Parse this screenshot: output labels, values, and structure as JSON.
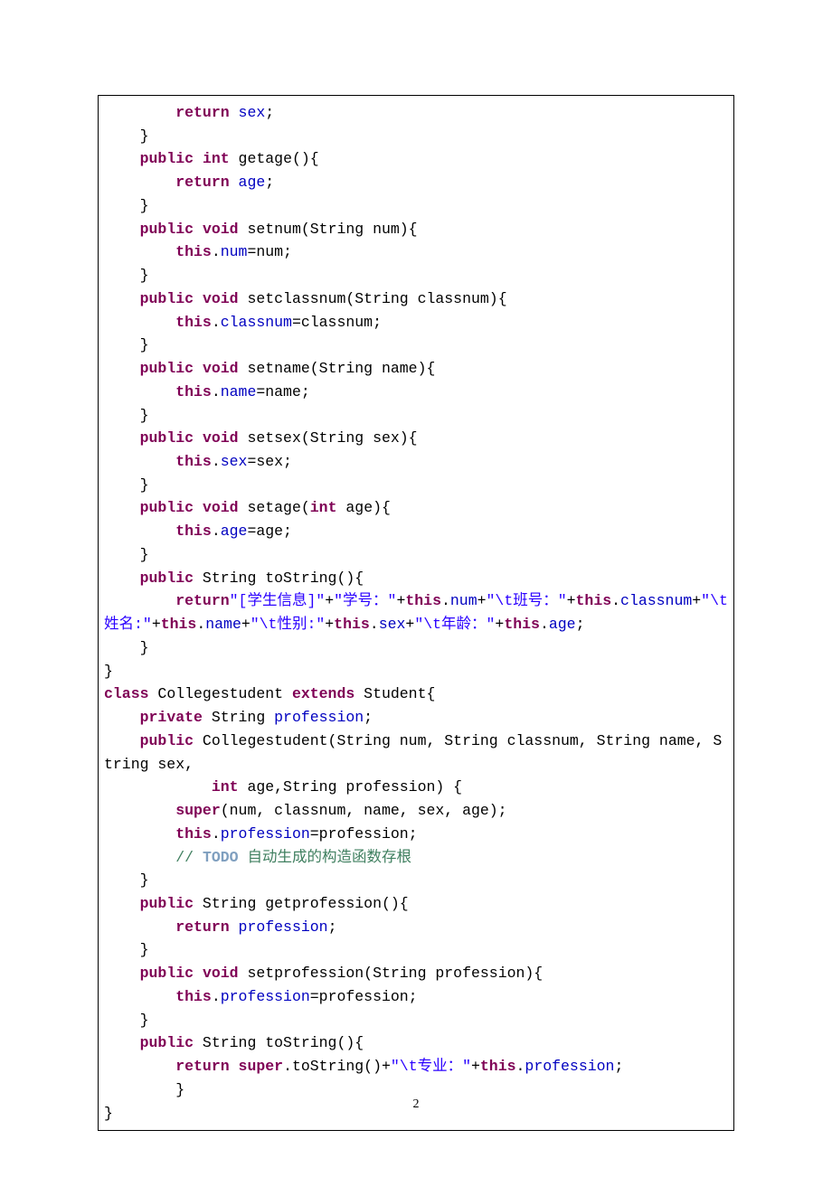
{
  "page_number": "2",
  "code": {
    "tokens": [
      {
        "t": "        ",
        "c": null
      },
      {
        "t": "return",
        "c": "kw"
      },
      {
        "t": " ",
        "c": null
      },
      {
        "t": "sex",
        "c": "fld"
      },
      {
        "t": ";",
        "c": null
      },
      {
        "t": "\n",
        "c": null
      },
      {
        "t": "    }",
        "c": null
      },
      {
        "t": "\n",
        "c": null
      },
      {
        "t": "    ",
        "c": null
      },
      {
        "t": "public",
        "c": "kw"
      },
      {
        "t": " ",
        "c": null
      },
      {
        "t": "int",
        "c": "kw"
      },
      {
        "t": " getage(){",
        "c": null
      },
      {
        "t": "\n",
        "c": null
      },
      {
        "t": "        ",
        "c": null
      },
      {
        "t": "return",
        "c": "kw"
      },
      {
        "t": " ",
        "c": null
      },
      {
        "t": "age",
        "c": "fld"
      },
      {
        "t": ";",
        "c": null
      },
      {
        "t": "\n",
        "c": null
      },
      {
        "t": "    }",
        "c": null
      },
      {
        "t": "\n",
        "c": null
      },
      {
        "t": "    ",
        "c": null
      },
      {
        "t": "public",
        "c": "kw"
      },
      {
        "t": " ",
        "c": null
      },
      {
        "t": "void",
        "c": "kw"
      },
      {
        "t": " setnum(String num){",
        "c": null
      },
      {
        "t": "\n",
        "c": null
      },
      {
        "t": "        ",
        "c": null
      },
      {
        "t": "this",
        "c": "kw"
      },
      {
        "t": ".",
        "c": null
      },
      {
        "t": "num",
        "c": "fld"
      },
      {
        "t": "=num;",
        "c": null
      },
      {
        "t": "\n",
        "c": null
      },
      {
        "t": "    }",
        "c": null
      },
      {
        "t": "\n",
        "c": null
      },
      {
        "t": "    ",
        "c": null
      },
      {
        "t": "public",
        "c": "kw"
      },
      {
        "t": " ",
        "c": null
      },
      {
        "t": "void",
        "c": "kw"
      },
      {
        "t": " setclassnum(String classnum){",
        "c": null
      },
      {
        "t": "\n",
        "c": null
      },
      {
        "t": "        ",
        "c": null
      },
      {
        "t": "this",
        "c": "kw"
      },
      {
        "t": ".",
        "c": null
      },
      {
        "t": "classnum",
        "c": "fld"
      },
      {
        "t": "=classnum;",
        "c": null
      },
      {
        "t": "\n",
        "c": null
      },
      {
        "t": "    }",
        "c": null
      },
      {
        "t": "\n",
        "c": null
      },
      {
        "t": "    ",
        "c": null
      },
      {
        "t": "public",
        "c": "kw"
      },
      {
        "t": " ",
        "c": null
      },
      {
        "t": "void",
        "c": "kw"
      },
      {
        "t": " setname(String name){",
        "c": null
      },
      {
        "t": "\n",
        "c": null
      },
      {
        "t": "        ",
        "c": null
      },
      {
        "t": "this",
        "c": "kw"
      },
      {
        "t": ".",
        "c": null
      },
      {
        "t": "name",
        "c": "fld"
      },
      {
        "t": "=name;",
        "c": null
      },
      {
        "t": "\n",
        "c": null
      },
      {
        "t": "    }",
        "c": null
      },
      {
        "t": "\n",
        "c": null
      },
      {
        "t": "    ",
        "c": null
      },
      {
        "t": "public",
        "c": "kw"
      },
      {
        "t": " ",
        "c": null
      },
      {
        "t": "void",
        "c": "kw"
      },
      {
        "t": " setsex(String sex){",
        "c": null
      },
      {
        "t": "\n",
        "c": null
      },
      {
        "t": "        ",
        "c": null
      },
      {
        "t": "this",
        "c": "kw"
      },
      {
        "t": ".",
        "c": null
      },
      {
        "t": "sex",
        "c": "fld"
      },
      {
        "t": "=sex;",
        "c": null
      },
      {
        "t": "\n",
        "c": null
      },
      {
        "t": "    }",
        "c": null
      },
      {
        "t": "\n",
        "c": null
      },
      {
        "t": "    ",
        "c": null
      },
      {
        "t": "public",
        "c": "kw"
      },
      {
        "t": " ",
        "c": null
      },
      {
        "t": "void",
        "c": "kw"
      },
      {
        "t": " setage(",
        "c": null
      },
      {
        "t": "int",
        "c": "kw"
      },
      {
        "t": " age){",
        "c": null
      },
      {
        "t": "\n",
        "c": null
      },
      {
        "t": "        ",
        "c": null
      },
      {
        "t": "this",
        "c": "kw"
      },
      {
        "t": ".",
        "c": null
      },
      {
        "t": "age",
        "c": "fld"
      },
      {
        "t": "=age;",
        "c": null
      },
      {
        "t": "\n",
        "c": null
      },
      {
        "t": "    }",
        "c": null
      },
      {
        "t": "\n",
        "c": null
      },
      {
        "t": "    ",
        "c": null
      },
      {
        "t": "public",
        "c": "kw"
      },
      {
        "t": " String toString(){",
        "c": null
      },
      {
        "t": "\n",
        "c": null
      },
      {
        "t": "        ",
        "c": null
      },
      {
        "t": "return",
        "c": "kw"
      },
      {
        "t": "\"[学生信息]\"",
        "c": "str"
      },
      {
        "t": "+",
        "c": null
      },
      {
        "t": "\"学号：\"",
        "c": "str"
      },
      {
        "t": "+",
        "c": null
      },
      {
        "t": "this",
        "c": "kw"
      },
      {
        "t": ".",
        "c": null
      },
      {
        "t": "num",
        "c": "fld"
      },
      {
        "t": "+",
        "c": null
      },
      {
        "t": "\"\\t班号：\"",
        "c": "str"
      },
      {
        "t": "+",
        "c": null
      },
      {
        "t": "this",
        "c": "kw"
      },
      {
        "t": ".",
        "c": null
      },
      {
        "t": "classnum",
        "c": "fld"
      },
      {
        "t": "+",
        "c": null
      },
      {
        "t": "\"\\t姓名:\"",
        "c": "str"
      },
      {
        "t": "+",
        "c": null
      },
      {
        "t": "this",
        "c": "kw"
      },
      {
        "t": ".",
        "c": null
      },
      {
        "t": "name",
        "c": "fld"
      },
      {
        "t": "+",
        "c": null
      },
      {
        "t": "\"\\t性别:\"",
        "c": "str"
      },
      {
        "t": "+",
        "c": null
      },
      {
        "t": "this",
        "c": "kw"
      },
      {
        "t": ".",
        "c": null
      },
      {
        "t": "sex",
        "c": "fld"
      },
      {
        "t": "+",
        "c": null
      },
      {
        "t": "\"\\t年龄：\"",
        "c": "str"
      },
      {
        "t": "+",
        "c": null
      },
      {
        "t": "this",
        "c": "kw"
      },
      {
        "t": ".",
        "c": null
      },
      {
        "t": "age",
        "c": "fld"
      },
      {
        "t": ";",
        "c": null
      },
      {
        "t": "\n",
        "c": null
      },
      {
        "t": "    }",
        "c": null
      },
      {
        "t": "\n",
        "c": null
      },
      {
        "t": "}",
        "c": null
      },
      {
        "t": "\n",
        "c": null
      },
      {
        "t": "class",
        "c": "kw"
      },
      {
        "t": " Collegestudent ",
        "c": null
      },
      {
        "t": "extends",
        "c": "kw"
      },
      {
        "t": " Student{",
        "c": null
      },
      {
        "t": "\n",
        "c": null
      },
      {
        "t": "    ",
        "c": null
      },
      {
        "t": "private",
        "c": "kw"
      },
      {
        "t": " String ",
        "c": null
      },
      {
        "t": "profession",
        "c": "fld"
      },
      {
        "t": ";",
        "c": null
      },
      {
        "t": "\n",
        "c": null
      },
      {
        "t": "    ",
        "c": null
      },
      {
        "t": "public",
        "c": "kw"
      },
      {
        "t": " Collegestudent(String num, String classnum, String name, String sex,",
        "c": null
      },
      {
        "t": "\n",
        "c": null
      },
      {
        "t": "            ",
        "c": null
      },
      {
        "t": "int",
        "c": "kw"
      },
      {
        "t": " age,String profession) {",
        "c": null
      },
      {
        "t": "\n",
        "c": null
      },
      {
        "t": "        ",
        "c": null
      },
      {
        "t": "super",
        "c": "kw"
      },
      {
        "t": "(num, classnum, name, sex, age);",
        "c": null
      },
      {
        "t": "\n",
        "c": null
      },
      {
        "t": "        ",
        "c": null
      },
      {
        "t": "this",
        "c": "kw"
      },
      {
        "t": ".",
        "c": null
      },
      {
        "t": "profession",
        "c": "fld"
      },
      {
        "t": "=profession;",
        "c": null
      },
      {
        "t": "\n",
        "c": null
      },
      {
        "t": "        ",
        "c": null
      },
      {
        "t": "// ",
        "c": "cmt"
      },
      {
        "t": "TODO",
        "c": "todo"
      },
      {
        "t": " 自动生成的构造函数存根",
        "c": "cmt"
      },
      {
        "t": "\n",
        "c": null
      },
      {
        "t": "    }",
        "c": null
      },
      {
        "t": "\n",
        "c": null
      },
      {
        "t": "    ",
        "c": null
      },
      {
        "t": "public",
        "c": "kw"
      },
      {
        "t": " String getprofession(){",
        "c": null
      },
      {
        "t": "\n",
        "c": null
      },
      {
        "t": "        ",
        "c": null
      },
      {
        "t": "return",
        "c": "kw"
      },
      {
        "t": " ",
        "c": null
      },
      {
        "t": "profession",
        "c": "fld"
      },
      {
        "t": ";",
        "c": null
      },
      {
        "t": "\n",
        "c": null
      },
      {
        "t": "    }",
        "c": null
      },
      {
        "t": "\n",
        "c": null
      },
      {
        "t": "    ",
        "c": null
      },
      {
        "t": "public",
        "c": "kw"
      },
      {
        "t": " ",
        "c": null
      },
      {
        "t": "void",
        "c": "kw"
      },
      {
        "t": " setprofession(String profession){",
        "c": null
      },
      {
        "t": "\n",
        "c": null
      },
      {
        "t": "        ",
        "c": null
      },
      {
        "t": "this",
        "c": "kw"
      },
      {
        "t": ".",
        "c": null
      },
      {
        "t": "profession",
        "c": "fld"
      },
      {
        "t": "=profession;",
        "c": null
      },
      {
        "t": "\n",
        "c": null
      },
      {
        "t": "    }",
        "c": null
      },
      {
        "t": "\n",
        "c": null
      },
      {
        "t": "    ",
        "c": null
      },
      {
        "t": "public",
        "c": "kw"
      },
      {
        "t": " String toString(){",
        "c": null
      },
      {
        "t": "\n",
        "c": null
      },
      {
        "t": "        ",
        "c": null
      },
      {
        "t": "return",
        "c": "kw"
      },
      {
        "t": " ",
        "c": null
      },
      {
        "t": "super",
        "c": "kw"
      },
      {
        "t": ".toString()+",
        "c": null
      },
      {
        "t": "\"\\t专业：\"",
        "c": "str"
      },
      {
        "t": "+",
        "c": null
      },
      {
        "t": "this",
        "c": "kw"
      },
      {
        "t": ".",
        "c": null
      },
      {
        "t": "profession",
        "c": "fld"
      },
      {
        "t": ";",
        "c": null
      },
      {
        "t": "\n",
        "c": null
      },
      {
        "t": "        }",
        "c": null
      },
      {
        "t": "\n",
        "c": null
      },
      {
        "t": "}",
        "c": null
      }
    ]
  }
}
